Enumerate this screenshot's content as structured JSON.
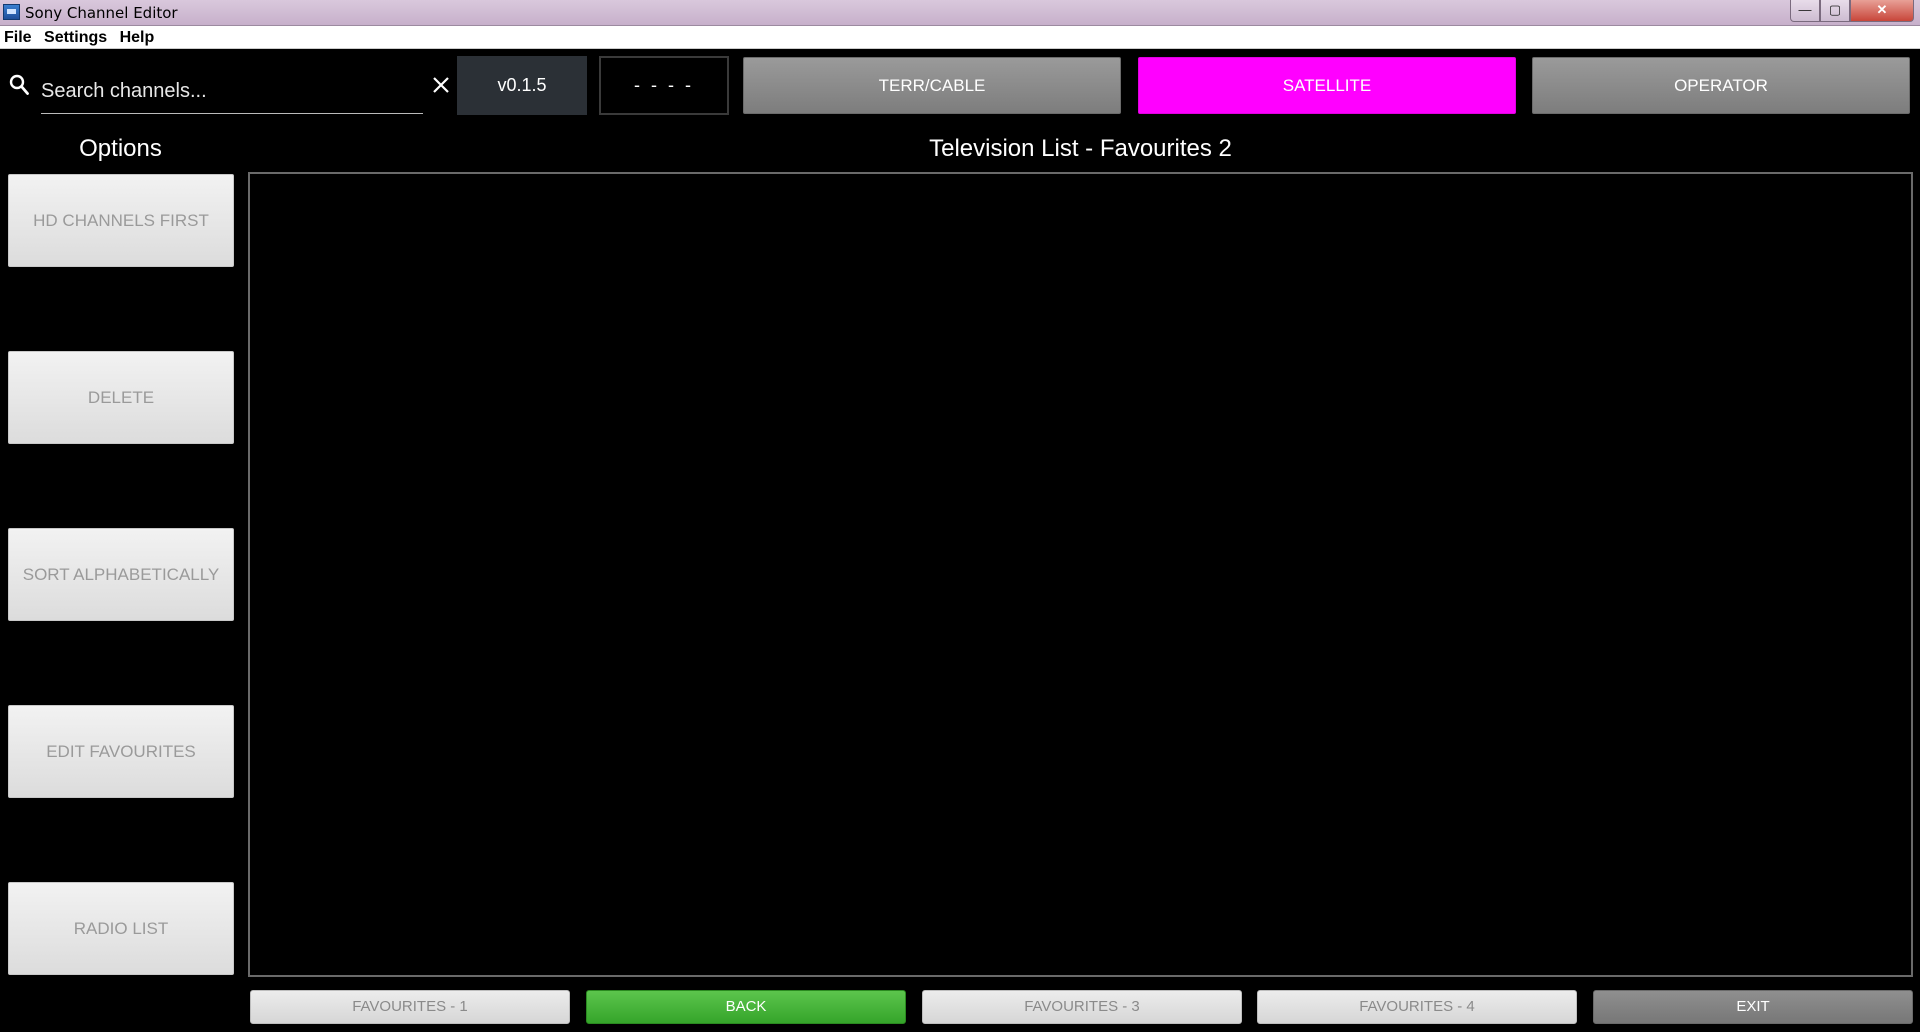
{
  "window": {
    "title": "Sony Channel Editor",
    "controls": {
      "minimize": "—",
      "maximize": "▢",
      "close": "✕"
    }
  },
  "menu": [
    "File",
    "Settings",
    "Help"
  ],
  "search": {
    "placeholder": "Search channels...",
    "value": ""
  },
  "version": "v0.1.5",
  "status": "- - - -",
  "modes": [
    {
      "label": "TERR/CABLE",
      "active": false
    },
    {
      "label": "SATELLITE",
      "active": true
    },
    {
      "label": "OPERATOR",
      "active": false
    }
  ],
  "options": {
    "title": "Options",
    "buttons": [
      "HD CHANNELS FIRST",
      "DELETE",
      "SORT ALPHABETICALLY",
      "EDIT FAVOURITES",
      "RADIO LIST"
    ]
  },
  "list": {
    "title": "Television List - Favourites 2",
    "items": []
  },
  "bottom": [
    "FAVOURITES - 1",
    "BACK",
    "FAVOURITES - 3",
    "FAVOURITES - 4",
    "EXIT"
  ],
  "colors": {
    "active_mode": "#ff00ff",
    "back_button": "#3fb134",
    "background": "#000000"
  }
}
